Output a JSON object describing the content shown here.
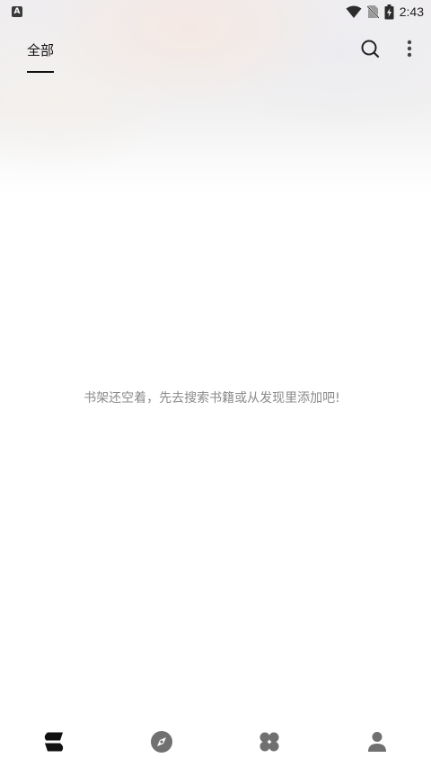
{
  "status_bar": {
    "left_icon": "A",
    "time": "2:43",
    "icons": [
      "wifi-icon",
      "no-sim-icon",
      "battery-charging-icon"
    ]
  },
  "header": {
    "tab_label": "全部",
    "actions": [
      "search-icon",
      "more-vertical-icon"
    ]
  },
  "main": {
    "empty_message": "书架还空着，先去搜索书籍或从发现里添加吧!"
  },
  "bottom_nav": {
    "items": [
      "bookshelf-icon",
      "discover-icon",
      "apps-icon",
      "profile-icon"
    ],
    "active_index": 0
  },
  "colors": {
    "primary_text": "#111111",
    "muted_text": "#8a8a8a",
    "icon_inactive": "#707070"
  }
}
